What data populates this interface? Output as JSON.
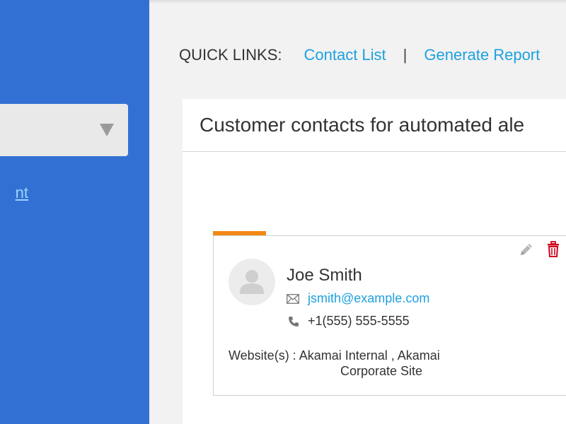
{
  "quick_links": {
    "title": "QUICK LINKS:",
    "separator": "|",
    "items": [
      "Contact List",
      "Generate Report"
    ]
  },
  "sidebar": {
    "link_label": "nt"
  },
  "panel": {
    "title": "Customer contacts for automated ale"
  },
  "contact": {
    "name": "Joe Smith",
    "email": "jsmith@example.com",
    "phone": "+1(555) 555-5555",
    "websites_label": "Website(s) :",
    "websites_line1": "Akamai Internal , Akamai",
    "websites_line2": "Corporate Site"
  },
  "icons": {
    "edit": "pencil-icon",
    "delete": "trash-icon",
    "avatar": "user-placeholder-icon",
    "email": "envelope-icon",
    "phone": "phone-icon",
    "select": "caret-down-icon"
  },
  "colors": {
    "sidebar": "#3271d3",
    "link": "#1ea1de",
    "accent": "#f28a16",
    "delete": "#d0021b"
  }
}
